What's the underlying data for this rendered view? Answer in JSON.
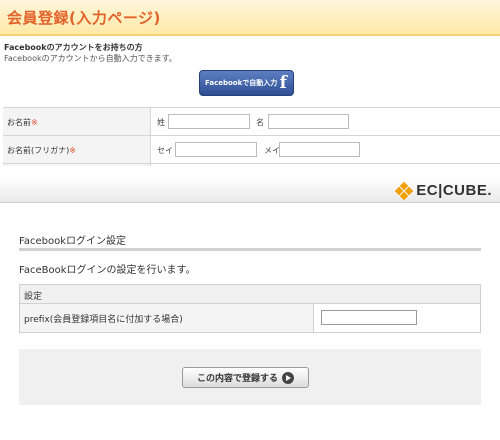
{
  "preview": {
    "title": "会員登録(入力ページ)",
    "facebook_heading": "Facebookのアカウントをお持ちの方",
    "facebook_subtext": "Facebookのアカウントから自動入力できます。",
    "facebook_button_label": "Facebookで自動入力",
    "facebook_logo_letter": "f",
    "rows": [
      {
        "label": "お名前",
        "required_mark": "※",
        "first_sub": "姓",
        "second_sub": "名"
      },
      {
        "label": "お名前(フリガナ)",
        "required_mark": "※",
        "first_sub": "セイ",
        "second_sub": "メイ"
      }
    ]
  },
  "admin": {
    "logo_text": "EC|CUBE.",
    "brand_color": "#f1a000"
  },
  "settings": {
    "title": "Facebookログイン設定",
    "description": "FaceBookログインの設定を行います。",
    "table_header": "設定",
    "rows": [
      {
        "label": "prefix(会員登録項目名に付加する場合)",
        "value": ""
      }
    ],
    "submit_label": "この内容で登録する"
  }
}
